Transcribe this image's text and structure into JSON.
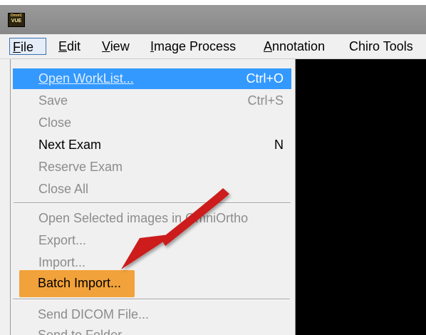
{
  "app": {
    "logo_text_top": "OmniC",
    "logo_text_bottom": "VUE"
  },
  "menubar": {
    "items": [
      {
        "label": "File",
        "mnemonic": "F",
        "rest": "ile"
      },
      {
        "label": "Edit",
        "mnemonic": "E",
        "rest": "dit"
      },
      {
        "label": "View",
        "mnemonic": "V",
        "rest": "iew"
      },
      {
        "label": "Image Process",
        "mnemonic": "I",
        "rest": "mage Process"
      },
      {
        "label": "Annotation",
        "mnemonic": "A",
        "rest": "nnotation"
      },
      {
        "label": "Chiro Tools"
      }
    ]
  },
  "file_menu": {
    "items": [
      {
        "label": "Open WorkList...",
        "shortcut": "Ctrl+O",
        "state": "selected"
      },
      {
        "label": "Save",
        "shortcut": "Ctrl+S",
        "state": "disabled"
      },
      {
        "label": "Close",
        "shortcut": "",
        "state": "disabled"
      },
      {
        "label": "Next Exam",
        "shortcut": "N",
        "state": "enabled"
      },
      {
        "label": "Reserve Exam",
        "shortcut": "",
        "state": "disabled"
      },
      {
        "label": "Close All",
        "shortcut": "",
        "state": "disabled"
      },
      {
        "label": "Open Selected images in OmniOrtho",
        "shortcut": "",
        "state": "disabled"
      },
      {
        "label": "Export...",
        "shortcut": "",
        "state": "disabled"
      },
      {
        "label": "Import...",
        "shortcut": "",
        "state": "disabled"
      },
      {
        "label": "Batch Import...",
        "shortcut": "",
        "state": "highlighted"
      },
      {
        "label": "Send DICOM File...",
        "shortcut": "",
        "state": "disabled"
      },
      {
        "label": "Send to Folder...",
        "shortcut": "",
        "state": "disabled"
      }
    ]
  },
  "annotation": {
    "arrow_color": "#cc1a1a",
    "highlight_color": "#f2a23a",
    "icon": "arrow-pointer-icon"
  },
  "colors": {
    "selection": "#3399ff",
    "viewport": "#000000",
    "titlebar": "#8e8e8e"
  }
}
